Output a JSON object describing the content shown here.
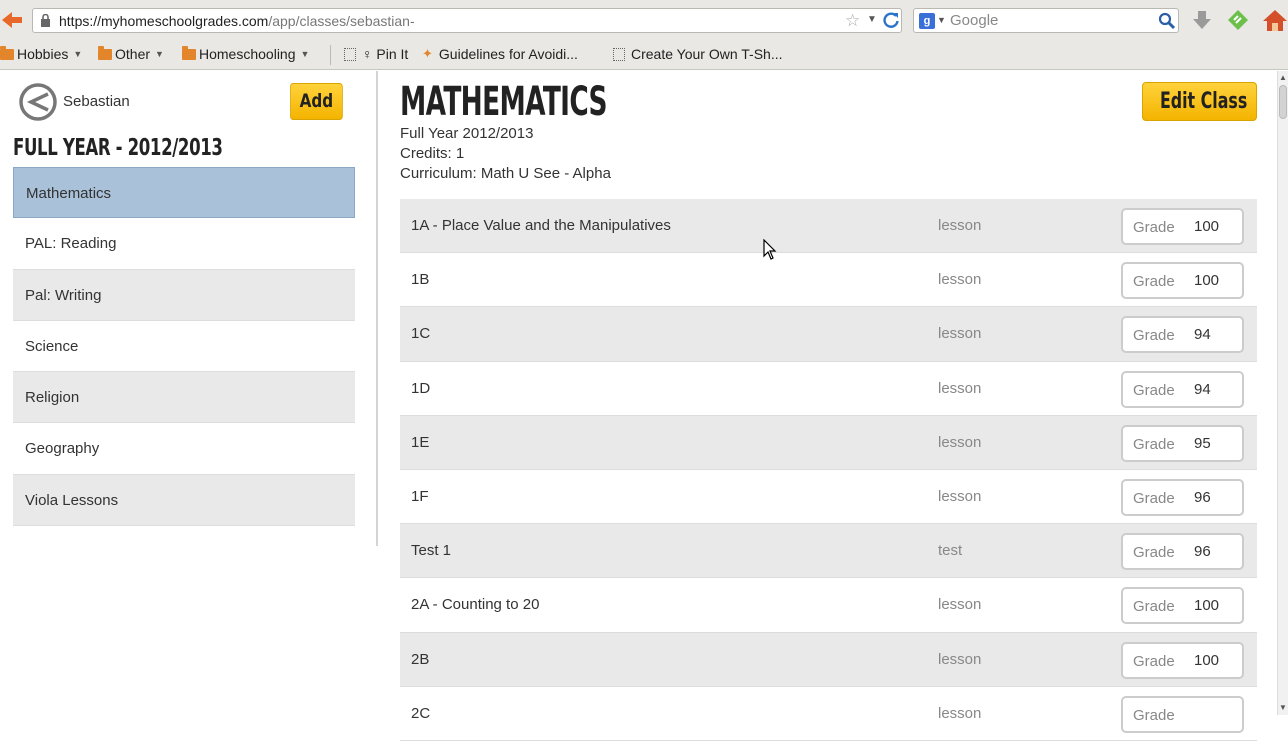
{
  "browser": {
    "url_host": "https://myhomeschoolgrades.com",
    "url_path": "/app/classes/sebastian-",
    "search_placeholder": "Google",
    "bookmarks": [
      {
        "label": "Hobbies",
        "kind": "folder",
        "dropdown": true
      },
      {
        "label": "Other",
        "kind": "folder",
        "dropdown": true
      },
      {
        "label": "Homeschooling",
        "kind": "folder",
        "dropdown": true
      },
      {
        "label": "♀ Pin It",
        "kind": "page",
        "dropdown": false
      },
      {
        "label": "Guidelines for Avoidi...",
        "kind": "page",
        "dropdown": false
      },
      {
        "label": "Create Your Own T-Sh...",
        "kind": "page",
        "dropdown": false
      }
    ]
  },
  "sidebar": {
    "student_name": "Sebastian",
    "add_label": "Add",
    "year_title": "FULL YEAR - 2012/2013",
    "classes": [
      {
        "label": "Mathematics",
        "active": true
      },
      {
        "label": "PAL: Reading",
        "active": false
      },
      {
        "label": "Pal: Writing",
        "active": false
      },
      {
        "label": "Science",
        "active": false
      },
      {
        "label": "Religion",
        "active": false
      },
      {
        "label": "Geography",
        "active": false
      },
      {
        "label": "Viola Lessons",
        "active": false
      }
    ]
  },
  "main": {
    "class_title": "MATHEMATICS",
    "edit_label": "Edit Class",
    "term": "Full Year 2012/2013",
    "credits": "Credits: 1",
    "curriculum": "Curriculum: Math U See - Alpha",
    "grade_label": "Grade",
    "assignments": [
      {
        "name": "1A - Place Value and the Manipulatives",
        "type": "lesson",
        "grade": "100"
      },
      {
        "name": "1B",
        "type": "lesson",
        "grade": "100"
      },
      {
        "name": "1C",
        "type": "lesson",
        "grade": "94"
      },
      {
        "name": "1D",
        "type": "lesson",
        "grade": "94"
      },
      {
        "name": "1E",
        "type": "lesson",
        "grade": "95"
      },
      {
        "name": "1F",
        "type": "lesson",
        "grade": "96"
      },
      {
        "name": "Test 1",
        "type": "test",
        "grade": "96"
      },
      {
        "name": "2A - Counting to 20",
        "type": "lesson",
        "grade": "100"
      },
      {
        "name": "2B",
        "type": "lesson",
        "grade": "100"
      },
      {
        "name": "2C",
        "type": "lesson",
        "grade": ""
      }
    ]
  },
  "colors": {
    "accent_button": "#f4b400",
    "active_class_bg": "#a9c1d9",
    "row_shade": "#e9e9e9"
  },
  "icons": [
    "back-arrow-icon",
    "lock-icon",
    "star-icon",
    "reload-icon",
    "google-icon",
    "search-icon",
    "download-icon",
    "feedly-icon",
    "home-icon",
    "folder-icon",
    "back-circle-icon",
    "mouse-cursor-icon"
  ]
}
